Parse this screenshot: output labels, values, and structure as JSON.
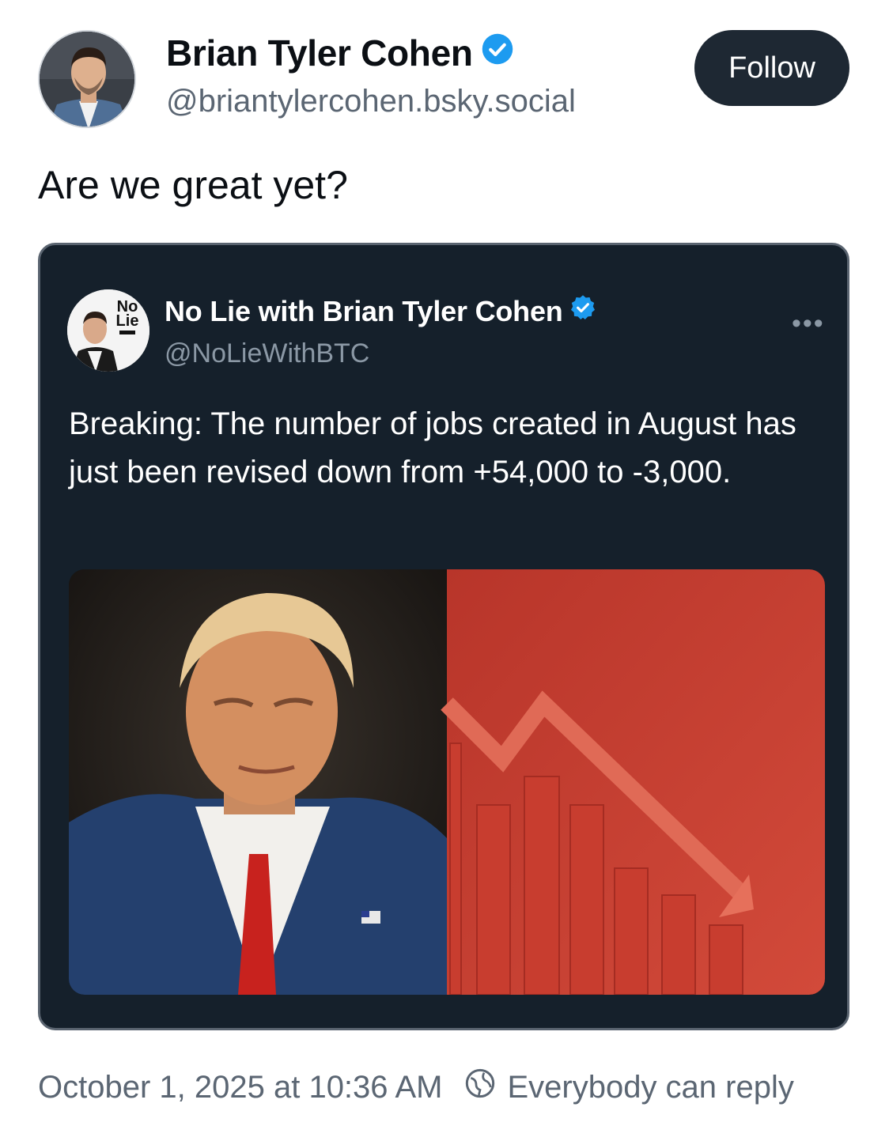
{
  "author": {
    "display_name": "Brian Tyler Cohen",
    "handle": "@briantylercohen.bsky.social",
    "verified_icon": "verified-check-icon"
  },
  "follow_label": "Follow",
  "post_text": "Are we great yet?",
  "quoted_post": {
    "display_name": "No Lie with Brian Tyler Cohen",
    "handle": "@NoLieWithBTC",
    "text": "Breaking: The number of jobs created in August has just been revised down from +54,000 to -3,000.",
    "avatar_badge_line1": "No",
    "avatar_badge_line2": "Lie"
  },
  "footer": {
    "timestamp": "October 1, 2025 at 10:36 AM",
    "reply_setting": "Everybody can reply"
  },
  "colors": {
    "accent_blue": "#1d9bf0",
    "follow_bg": "#1e2833",
    "embed_bg": "#15202b",
    "red": "#c8392b"
  }
}
